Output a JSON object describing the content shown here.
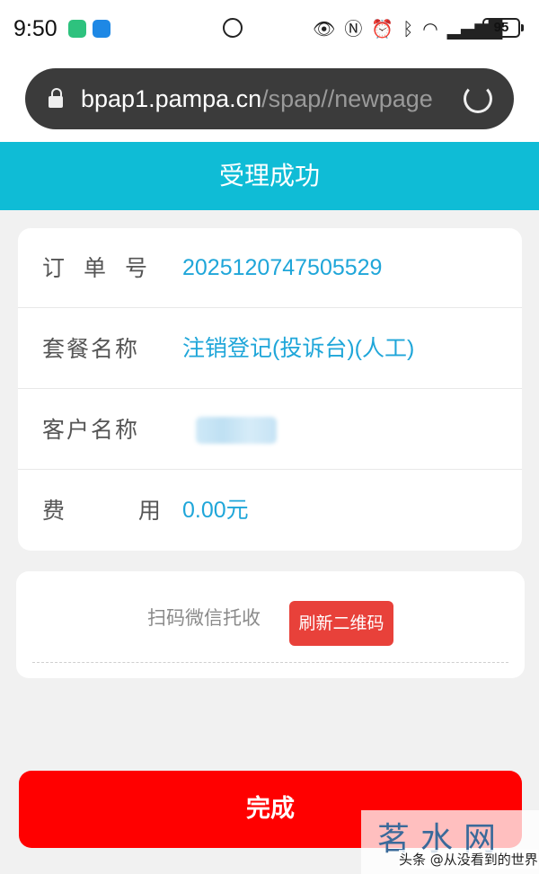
{
  "status_bar": {
    "time": "9:50",
    "battery": "95",
    "icons": [
      "eye-icon",
      "nfc-icon",
      "alarm-icon",
      "bluetooth-icon",
      "wifi-icon",
      "signal-icon"
    ]
  },
  "url_bar": {
    "host": "bpap1.pampa.cn",
    "path": "/spap//newpage"
  },
  "header": {
    "title": "受理成功"
  },
  "order": {
    "rows": [
      {
        "label": "订单号",
        "value": "2025120747505529"
      },
      {
        "label": "套餐名称",
        "value": "注销登记(投诉台)(人工)"
      },
      {
        "label": "客户名称",
        "value": ""
      },
      {
        "label": "费  用",
        "value": "0.00元"
      }
    ]
  },
  "qr": {
    "label": "扫码微信托收",
    "refresh_label": "刷新二维码"
  },
  "footer": {
    "done_label": "完成"
  },
  "watermark": {
    "logo": "茗水网",
    "caption": "头条 @从没看到的世界"
  },
  "colors": {
    "accent": "#0fbcd6",
    "value_text": "#1fa6d9",
    "primary_button": "#ff0000",
    "refresh_button": "#e8413a"
  }
}
